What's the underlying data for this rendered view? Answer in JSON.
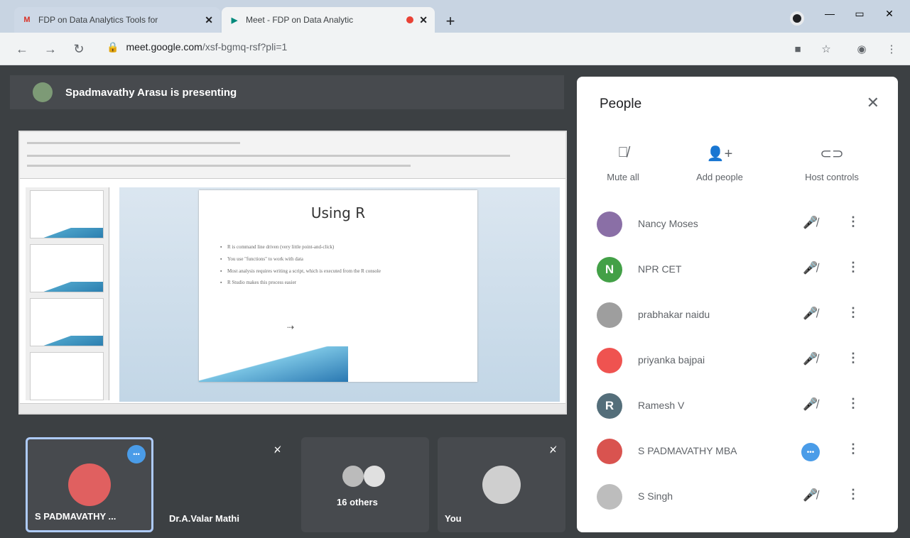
{
  "browser": {
    "tabs": [
      {
        "title": "FDP on Data Analytics Tools for",
        "favicon": "gmail-icon"
      },
      {
        "title": "Meet - FDP on Data Analytic",
        "favicon": "meet-icon"
      }
    ],
    "url_host": "meet.google.com",
    "url_path": "/xsf-bgmq-rsf?pli=1"
  },
  "meet": {
    "presenting_text": "Spadmavathy Arasu is presenting",
    "slide": {
      "title": "Using R",
      "bullets": [
        "R is command line driven (very little point-and-click)",
        "You use \"functions\" to work with data",
        "Most analysis requires writing a script, which is executed from the R console",
        "R Studio makes this process easier"
      ]
    },
    "tiles": [
      {
        "name": "S PADMAVATHY ...",
        "avatar_color": "#e06060"
      },
      {
        "name": "Dr.A.Valar Mathi"
      },
      {
        "name": "16 others"
      },
      {
        "name": "You"
      }
    ]
  },
  "panel": {
    "title": "People",
    "actions": [
      {
        "label": "Mute all",
        "icon": "mic-off-icon"
      },
      {
        "label": "Add people",
        "icon": "person-add-icon"
      },
      {
        "label": "Host controls",
        "icon": "toggle-icon"
      }
    ],
    "people": [
      {
        "name": "Nancy Moses",
        "initial": "",
        "color": "#8a6fa6"
      },
      {
        "name": "NPR CET",
        "initial": "N",
        "color": "#43a047"
      },
      {
        "name": "prabhakar naidu",
        "initial": "",
        "color": "#9e9e9e"
      },
      {
        "name": "priyanka bajpai",
        "initial": "",
        "color": "#ef5350"
      },
      {
        "name": "Ramesh V",
        "initial": "R",
        "color": "#546e7a"
      },
      {
        "name": "S PADMAVATHY MBA",
        "initial": "",
        "color": "#d9534f"
      },
      {
        "name": "S Singh",
        "initial": "",
        "color": "#bdbdbd"
      }
    ]
  }
}
